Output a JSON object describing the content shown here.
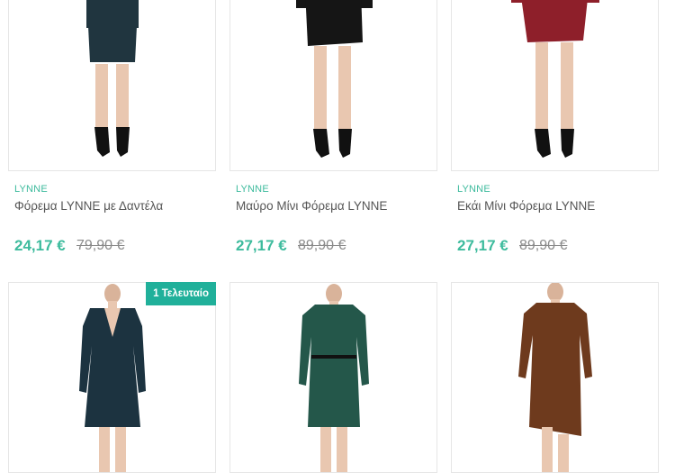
{
  "products": [
    {
      "brand": "LYNNE",
      "title": "Φόρεμα LYNNE με Δαντέλα",
      "price": "24,17 €",
      "old_price": "79,90 €",
      "dress_color": "#20353f"
    },
    {
      "brand": "LYNNE",
      "title": "Μαύρο Μίνι Φόρεμα LYNNE",
      "price": "27,17 €",
      "old_price": "89,90 €",
      "dress_color": "#151515"
    },
    {
      "brand": "LYNNE",
      "title": "Εκάι Μίνι Φόρεμα LYNNE",
      "price": "27,17 €",
      "old_price": "89,90 €",
      "dress_color": "#8e1f2a"
    },
    {
      "badge": "1 Τελευταίο",
      "dress_color": "#1c3340"
    },
    {
      "dress_color": "#24574a"
    },
    {
      "dress_color": "#6e3a1d"
    }
  ],
  "colors": {
    "accent": "#3dbb9d",
    "badge_bg": "#20b09a",
    "border": "#e6e6e6"
  }
}
